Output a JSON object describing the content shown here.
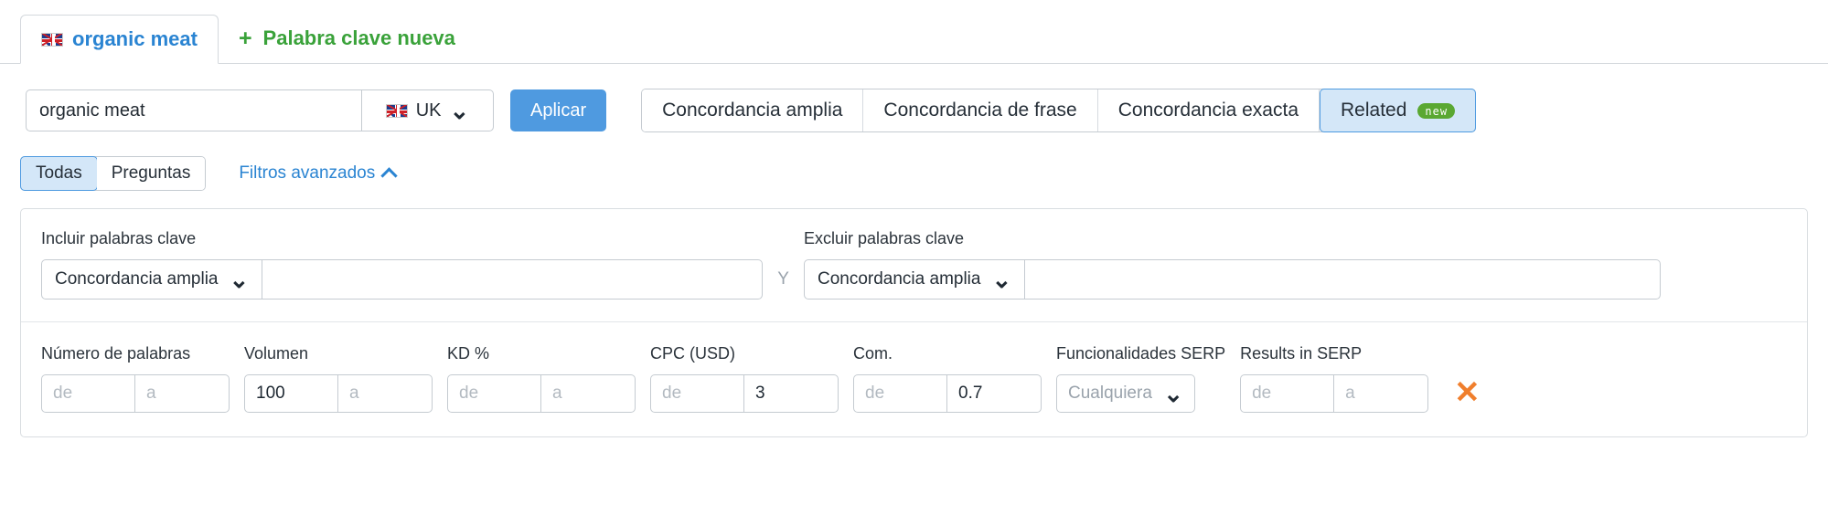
{
  "tabs": {
    "keyword_tab": {
      "label": "organic meat",
      "icon": "uk-flag-icon"
    },
    "new_keyword_tab": {
      "plus": "+",
      "label": "Palabra clave nueva"
    }
  },
  "search": {
    "keyword_value": "organic meat",
    "keyword_placeholder": "",
    "country": "UK",
    "country_icon": "uk-flag-icon",
    "dropdown_icon": "chevron-down-icon",
    "apply_label": "Aplicar"
  },
  "match_types": [
    {
      "label": "Concordancia amplia",
      "selected": false
    },
    {
      "label": "Concordancia de frase",
      "selected": false
    },
    {
      "label": "Concordancia exacta",
      "selected": false
    },
    {
      "label": "Related",
      "selected": true,
      "badge": "new"
    }
  ],
  "view_toggle": [
    {
      "label": "Todas",
      "selected": true
    },
    {
      "label": "Preguntas",
      "selected": false
    }
  ],
  "advanced_filters": {
    "label": "Filtros avanzados",
    "icon": "chevron-up-icon"
  },
  "filters": {
    "include": {
      "label": "Incluir palabras clave",
      "match": "Concordancia amplia",
      "value": "",
      "placeholder": ""
    },
    "separator": "Y",
    "exclude": {
      "label": "Excluir palabras clave",
      "match": "Concordancia amplia",
      "value": "",
      "placeholder": ""
    },
    "metrics": [
      {
        "name": "word-count",
        "label": "Número de palabras",
        "from": "",
        "to": "",
        "from_placeholder": "de",
        "to_placeholder": "a"
      },
      {
        "name": "volume",
        "label": "Volumen",
        "from": "100",
        "to": "",
        "from_placeholder": "de",
        "to_placeholder": "a"
      },
      {
        "name": "kd",
        "label": "KD %",
        "from": "",
        "to": "",
        "from_placeholder": "de",
        "to_placeholder": "a"
      },
      {
        "name": "cpc",
        "label": "CPC (USD)",
        "from": "",
        "to": "3",
        "from_placeholder": "de",
        "to_placeholder": "a"
      },
      {
        "name": "competition",
        "label": "Com.",
        "from": "",
        "to": "0.7",
        "from_placeholder": "de",
        "to_placeholder": "a"
      }
    ],
    "serp_features": {
      "label": "Funcionalidades SERP",
      "value": "Cualquiera",
      "icon": "chevron-down-icon"
    },
    "results_in_serp": {
      "label": "Results in SERP",
      "from": "",
      "to": "",
      "from_placeholder": "de",
      "to_placeholder": "a"
    },
    "clear_icon": "close-x-icon",
    "clear_glyph": "✕"
  },
  "colors": {
    "accent_blue": "#2a84d2",
    "button_blue": "#4f9ae0",
    "selected_bg": "#d4e7f8",
    "green": "#3aa23a",
    "badge_green": "#5aa832",
    "orange": "#f07f2d"
  }
}
